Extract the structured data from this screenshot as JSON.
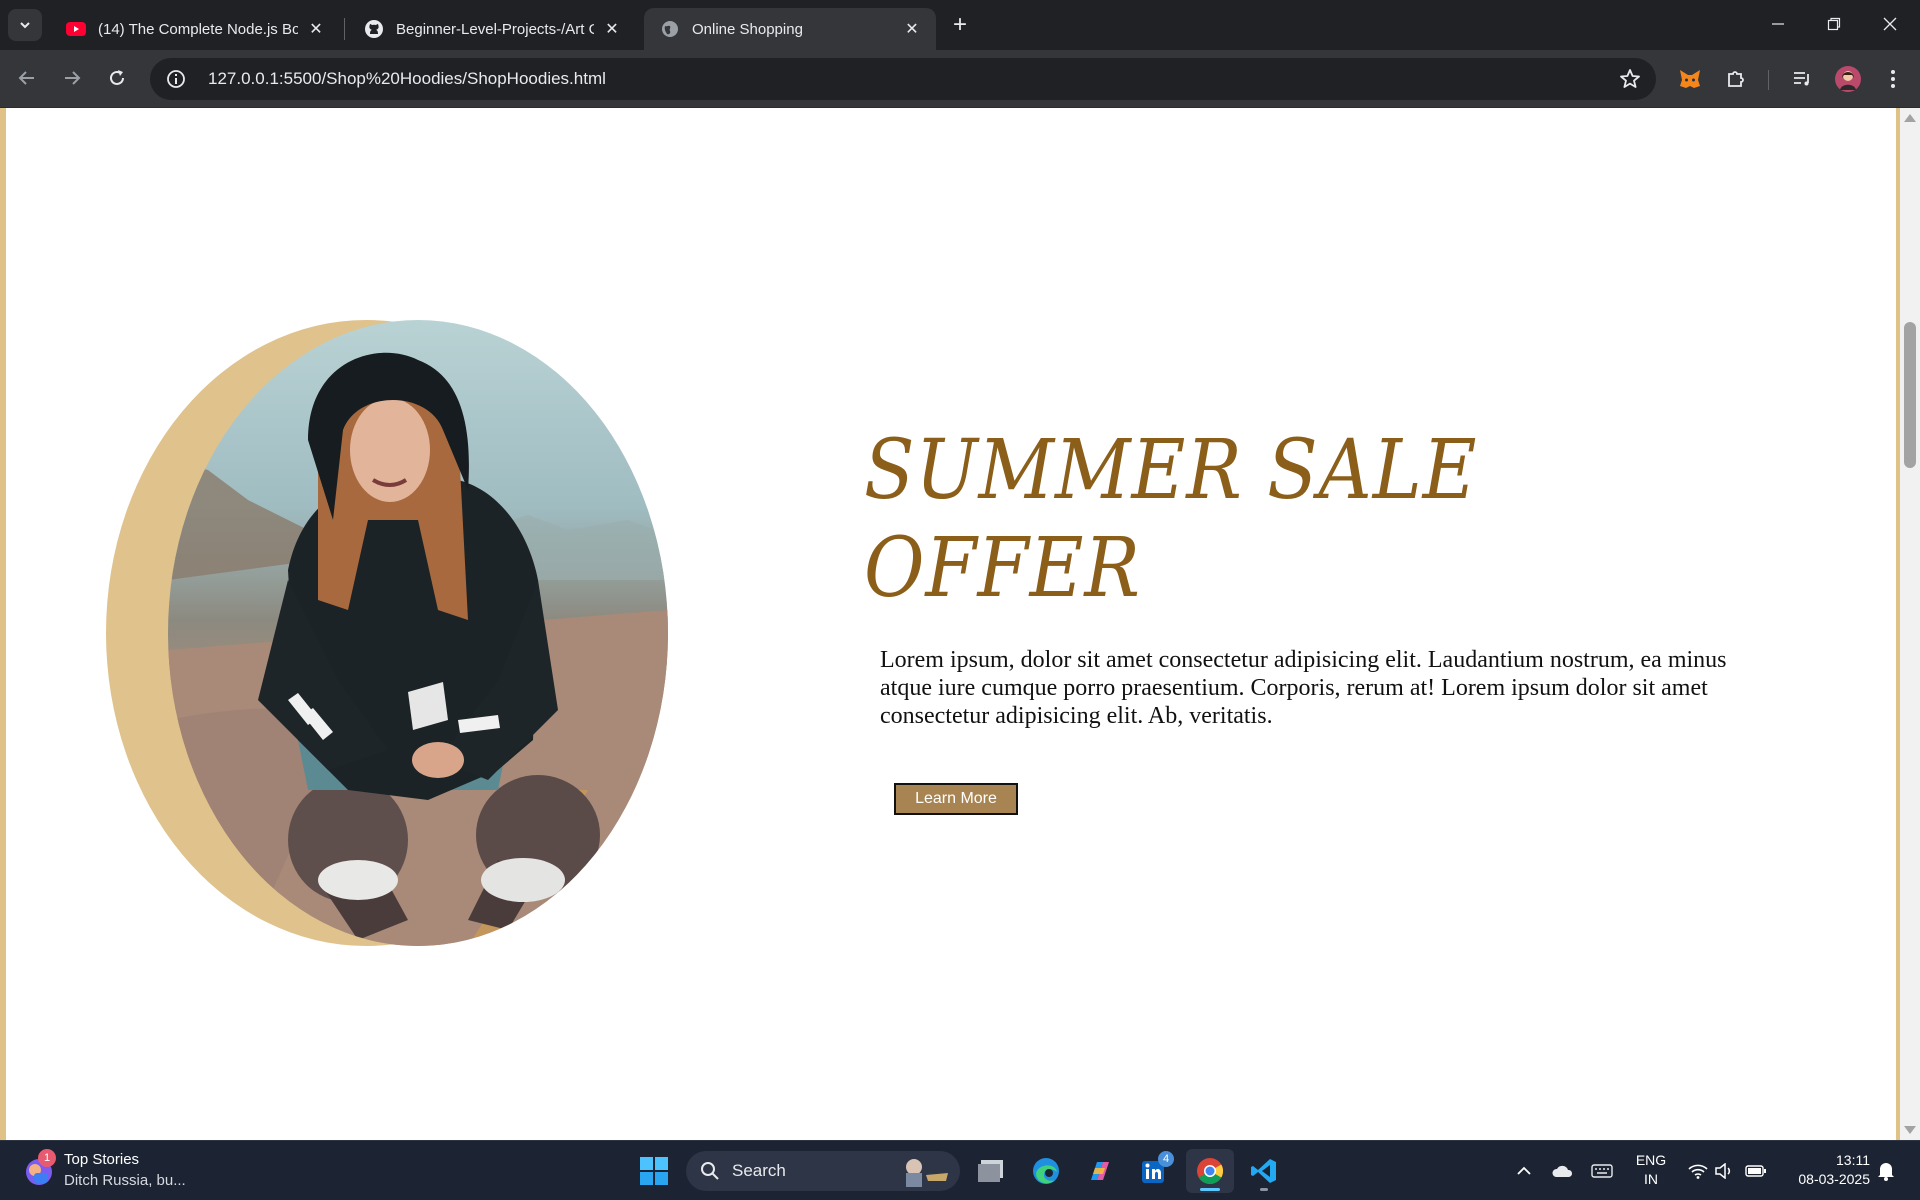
{
  "browser": {
    "tabs": [
      {
        "title": "(14) The Complete Node.js Boo",
        "icon": "youtube-icon"
      },
      {
        "title": "Beginner-Level-Projects-/Art Ga",
        "icon": "github-icon"
      },
      {
        "title": "Online Shopping",
        "icon": "globe-icon"
      }
    ],
    "active_tab": 2,
    "address": "127.0.0.1:5500/Shop%20Hoodies/ShopHoodies.html"
  },
  "page": {
    "headline_line1": "SUMMER SALE",
    "headline_line2": "OFFER",
    "description": "Lorem ipsum, dolor sit amet consectetur adipisicing elit. Laudantium nostrum, ea minus atque iure cumque porro praesentium. Corporis, rerum at! Lorem ipsum dolor sit amet consectetur adipisicing elit. Ab, veritatis.",
    "button_label": "Learn More",
    "colors": {
      "accent_gold": "#e0c28c",
      "title_brown": "#8b5f1a",
      "button_bg": "#a88452"
    }
  },
  "taskbar": {
    "news_badge": "1",
    "news_title": "Top Stories",
    "news_subtitle": "Ditch Russia, bu...",
    "search_label": "Search",
    "linkedin_badge": "4",
    "language_line1": "ENG",
    "language_line2": "IN",
    "time": "13:11",
    "date": "08-03-2025"
  }
}
